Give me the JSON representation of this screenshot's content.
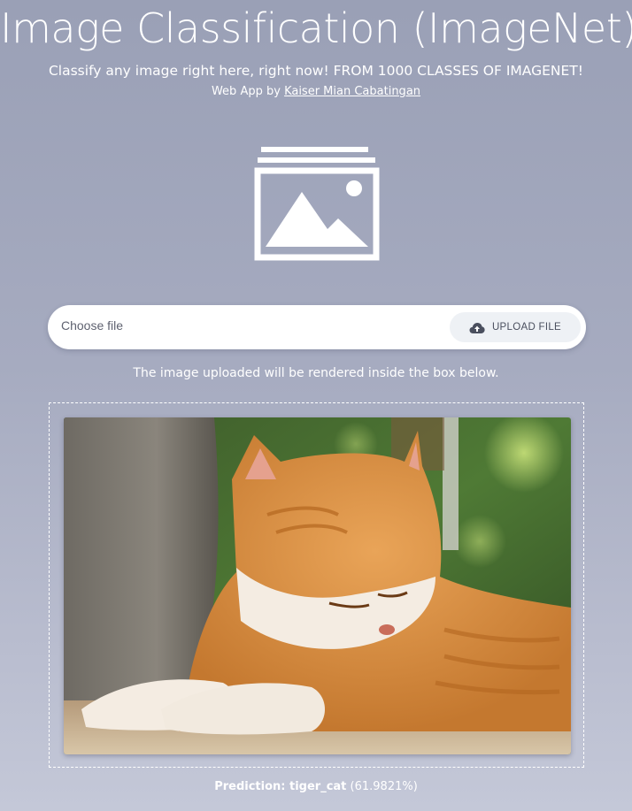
{
  "header": {
    "title": "Image Classification (ImageNet)",
    "subtitle": "Classify any image right here, right now! FROM 1000 CLASSES OF IMAGENET!",
    "byline_prefix": "Web App by ",
    "author_link": "Kaiser Mian Cabatingan"
  },
  "hero": {
    "icon": "image-stack-icon"
  },
  "upload": {
    "placeholder": "Choose file",
    "button_label": "UPLOAD FILE",
    "button_icon": "cloud-upload-icon"
  },
  "notice": "The image uploaded will be rendered inside the box below.",
  "preview": {
    "alt": "orange tabby cat lying with eyes closed"
  },
  "prediction": {
    "label": "Prediction: tiger_cat",
    "confidence": "(61.9821%)"
  },
  "colors": {
    "background_top": "#9aa0b6",
    "background_bottom": "#c4c8d8",
    "text": "#ffffff",
    "button_bg": "#eef1f5"
  }
}
